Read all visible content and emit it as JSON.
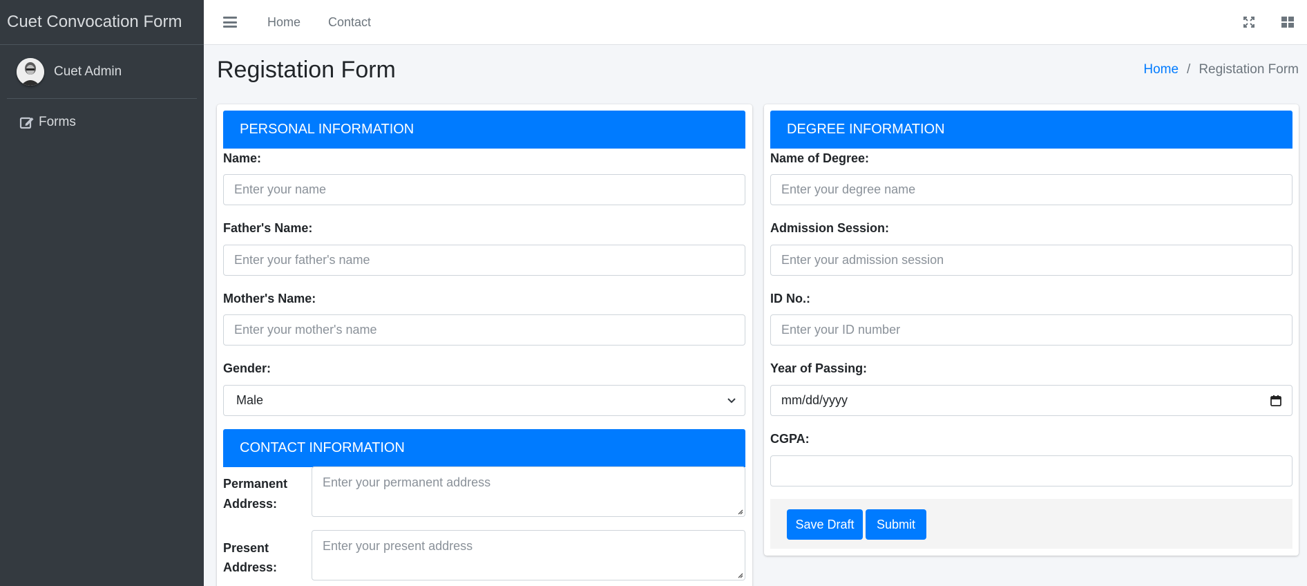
{
  "sidebar": {
    "brand": "Cuet Convocation Form",
    "user_name": "Cuet Admin",
    "items": [
      {
        "label": "Forms",
        "icon": "edit-icon"
      }
    ]
  },
  "navbar": {
    "links": [
      "Home",
      "Contact"
    ],
    "icons": [
      "menu-icon",
      "fullscreen-icon",
      "grid-icon"
    ]
  },
  "header": {
    "title": "Registation Form",
    "breadcrumb": {
      "home": "Home",
      "separator": "/",
      "current": "Registation Form"
    }
  },
  "personal": {
    "title": "PERSONAL INFORMATION",
    "name_label": "Name:",
    "name_placeholder": "Enter your name",
    "father_label": "Father's Name:",
    "father_placeholder": "Enter your father's name",
    "mother_label": "Mother's Name:",
    "mother_placeholder": "Enter your mother's name",
    "gender_label": "Gender:",
    "gender_value": "Male"
  },
  "contact": {
    "title": "CONTACT INFORMATION",
    "permanent_label_1": "Permanent",
    "permanent_label_2": "Address:",
    "permanent_placeholder": "Enter your permanent address",
    "present_label_1": "Present",
    "present_label_2": "Address:",
    "present_placeholder": "Enter your present address"
  },
  "degree": {
    "title": "DEGREE INFORMATION",
    "degree_label": "Name of Degree:",
    "degree_placeholder": "Enter your degree name",
    "session_label": "Admission Session:",
    "session_placeholder": "Enter your admission session",
    "id_label": "ID No.:",
    "id_placeholder": "Enter your ID number",
    "year_label": "Year of Passing:",
    "year_placeholder": "mm/dd/yyyy",
    "cgpa_label": "CGPA:",
    "cgpa_value": ""
  },
  "actions": {
    "save_draft": "Save Draft",
    "submit": "Submit"
  },
  "colors": {
    "primary": "#007bff",
    "sidebar": "#343a40",
    "background": "#f4f6f9"
  }
}
